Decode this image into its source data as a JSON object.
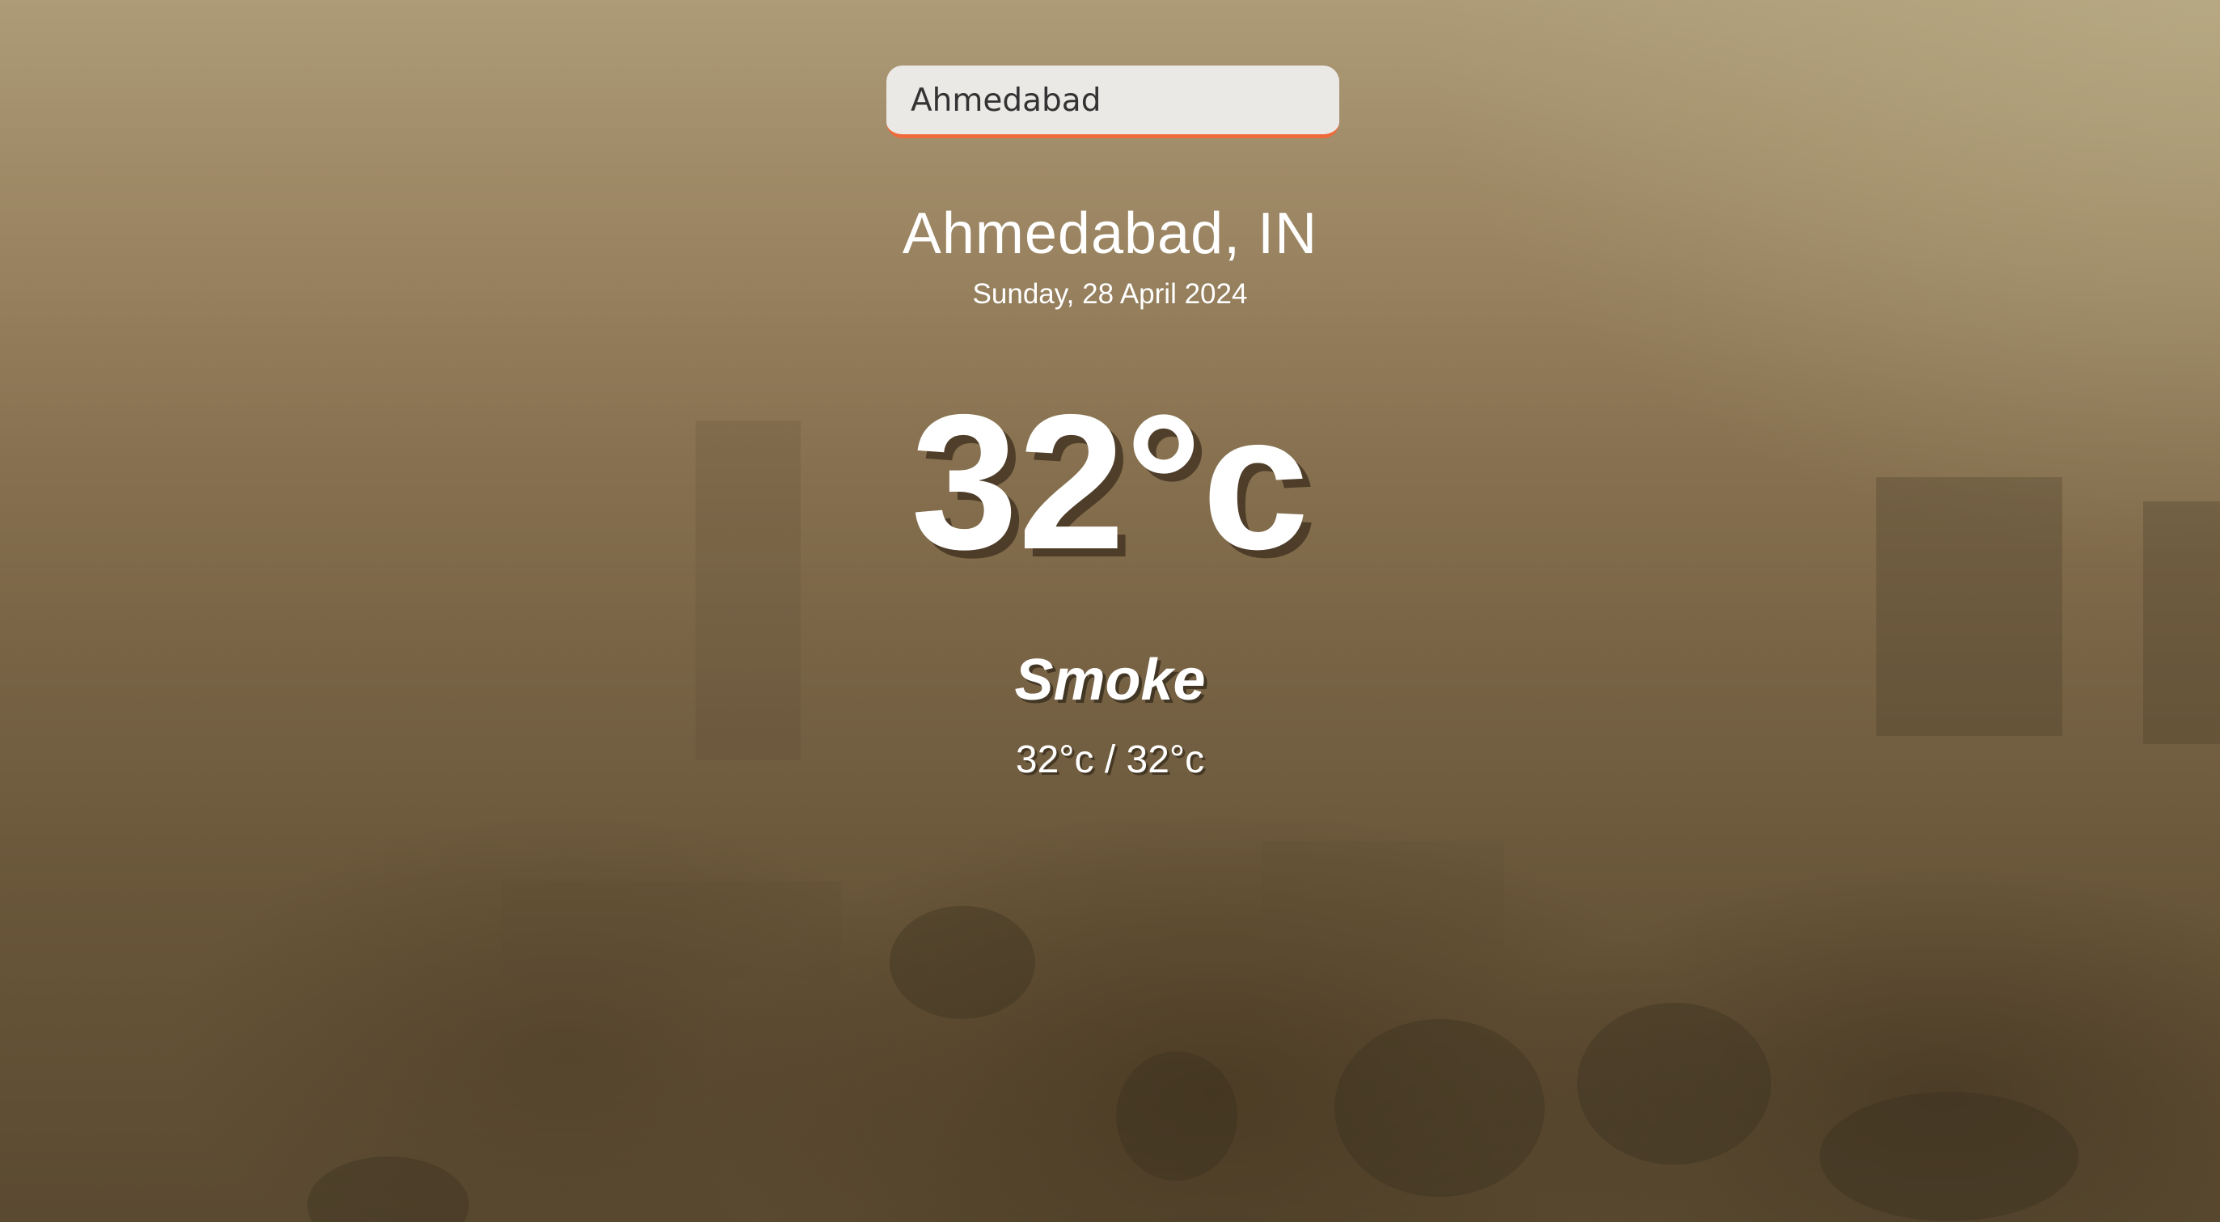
{
  "search": {
    "value": "Ahmedabad",
    "accent_color": "#ef6a3a"
  },
  "location": {
    "city": "Ahmedabad, IN",
    "date": "Sunday, 28 April 2024"
  },
  "weather": {
    "temperature": "32°c",
    "description": "Smoke",
    "hi_low": "32°c / 32°c"
  },
  "background": {
    "scene": "hazy-city-smoke"
  }
}
